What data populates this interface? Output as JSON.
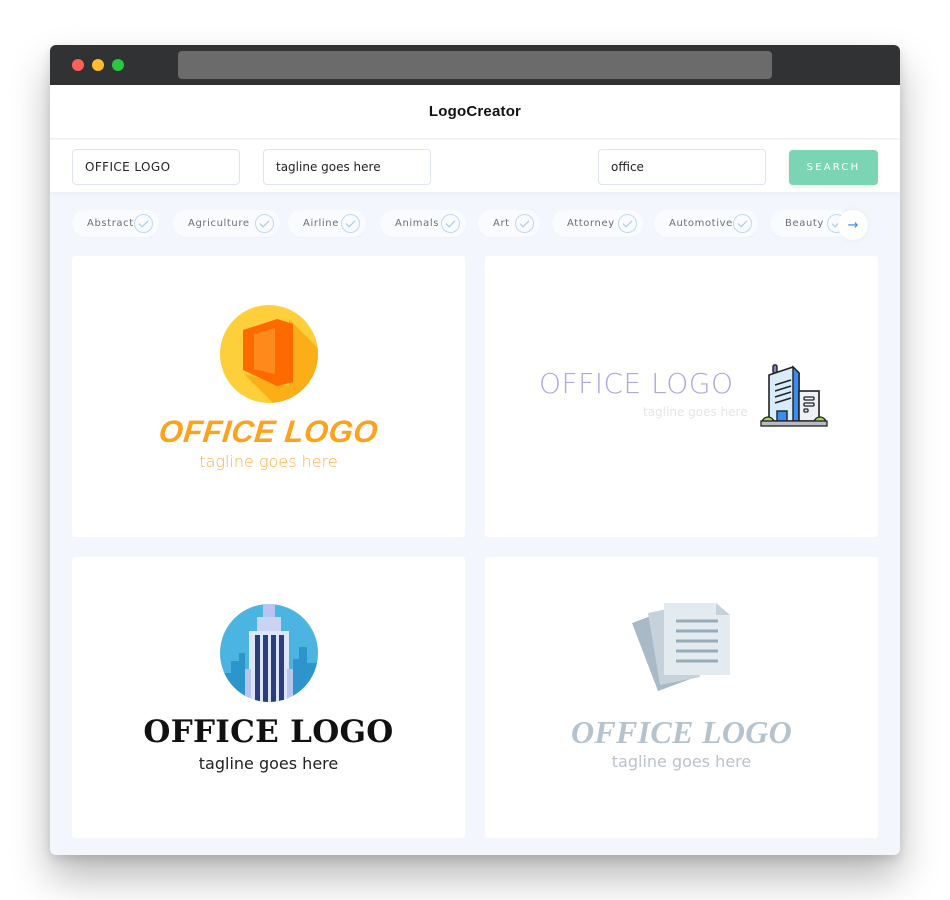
{
  "window": {
    "controls": [
      "close",
      "minimize",
      "maximize"
    ],
    "url": ""
  },
  "header": {
    "title": "LogoCreator"
  },
  "search": {
    "name_value": "OFFICE LOGO",
    "tagline_value": "tagline goes here",
    "keyword_value": "office",
    "button_label": "SEARCH",
    "button_color": "#7bd5b5"
  },
  "categories": [
    {
      "label": "Abstract"
    },
    {
      "label": "Agriculture"
    },
    {
      "label": "Airline"
    },
    {
      "label": "Animals"
    },
    {
      "label": "Art"
    },
    {
      "label": "Attorney"
    },
    {
      "label": "Automotive"
    },
    {
      "label": "Beauty"
    }
  ],
  "categories_next": {
    "icon": "arrow-right-icon",
    "glyph": "→"
  },
  "logos": [
    {
      "title": "OFFICE LOGO",
      "tagline": "tagline goes here",
      "icon": "office-door-circle-icon",
      "title_color": "#fda21d"
    },
    {
      "title": "OFFICE LOGO",
      "tagline": "tagline goes here",
      "icon": "office-building-icon",
      "title_color": "#aea8db"
    },
    {
      "title": "OFFICE LOGO",
      "tagline": "tagline goes here",
      "icon": "skyscraper-circle-icon",
      "title_color": "#111111"
    },
    {
      "title": "OFFICE LOGO",
      "tagline": "tagline goes here",
      "icon": "documents-icon",
      "title_color": "#b6c2cd"
    }
  ]
}
